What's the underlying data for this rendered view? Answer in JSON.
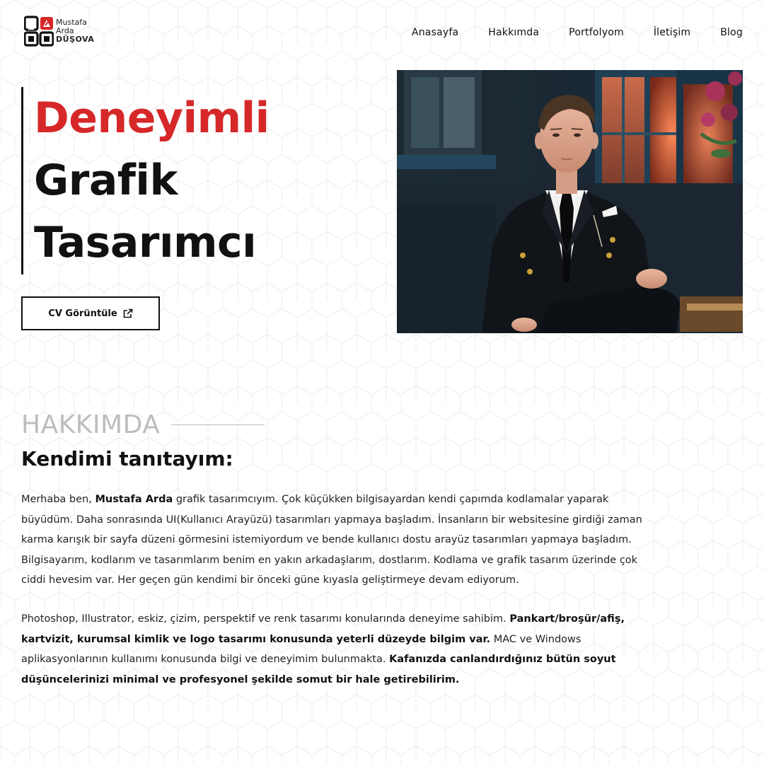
{
  "header": {
    "logo": {
      "line1": "Mustafa",
      "line2": "Arda",
      "line3": "DÜŞOVA"
    },
    "nav": [
      "Anasayfa",
      "Hakkımda",
      "Portfolyom",
      "İletişim",
      "Blog"
    ]
  },
  "hero": {
    "title_line1": "Deneyimli",
    "title_line2": "Grafik",
    "title_line3": "Tasarımcı",
    "cv_button": "CV Görüntüle",
    "accent_color": "#d62828"
  },
  "about": {
    "label": "HAKKIMDA",
    "heading": "Kendimi tanıtayım:",
    "p1": {
      "t1": "Merhaba ben, ",
      "b1": "Mustafa Arda",
      "t2": " grafik tasarımcıyım. Çok küçükken bilgisayardan kendi çapımda kodlamalar yaparak büyüdüm. Daha sonrasında UI(Kullanıcı Arayüzü) tasarımları yapmaya başladım. İnsanların bir websitesine girdiği zaman karma karışık bir sayfa düzeni görmesini istemiyordum ve bende kullanıcı dostu arayüz tasarımları yapmaya başladım. Bilgisayarım, kodlarım ve tasarımlarım benim en yakın arkadaşlarım, dostlarım. Kodlama ve grafik tasarım üzerinde çok ciddi hevesim var. Her geçen gün kendimi bir önceki güne kıyasla geliştirmeye devam ediyorum."
    },
    "p2": {
      "t1": "Photoshop, Illustrator, eskiz, çizim, perspektif ve renk tasarımı konularında deneyime sahibim. ",
      "b1": "Pankart/broşür/afiş, kartvizit, kurumsal kimlik ve logo tasarımı konusunda yeterli düzeyde bilgim var.",
      "t2": " MAC ve Windows aplikasyonlarının kullanımı konusunda bilgi ve deneyimim bulunmakta. ",
      "b2": "Kafanızda canlandırdığınız bütün soyut düşüncelerinizi minimal ve profesyonel şekilde somut bir hale getirebilirim."
    }
  }
}
